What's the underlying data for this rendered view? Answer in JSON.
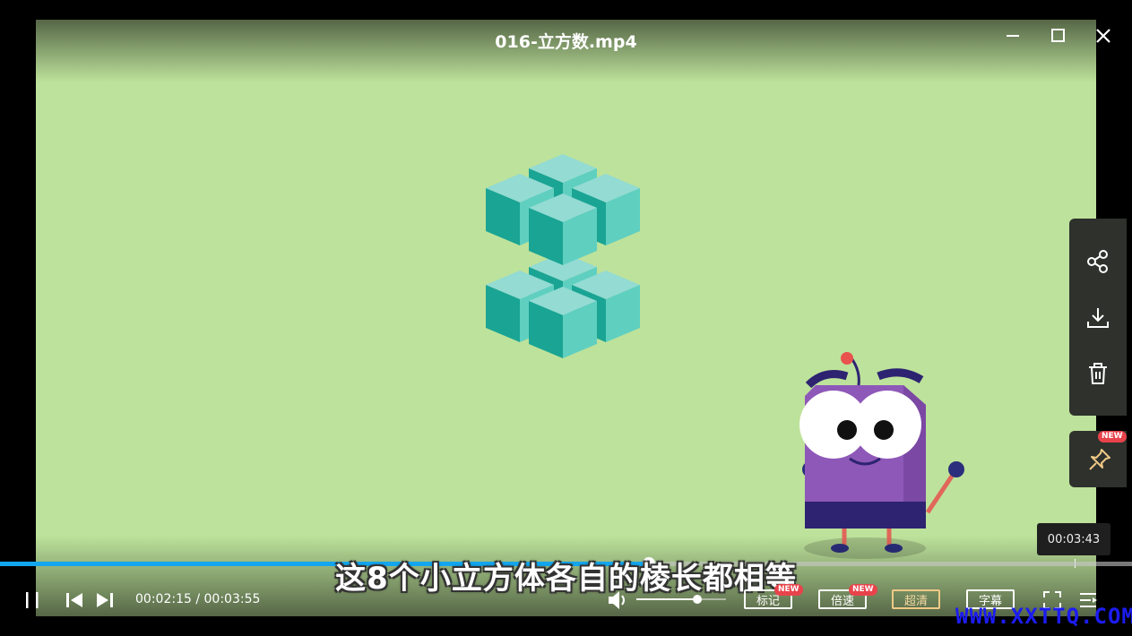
{
  "window": {
    "title": "016-立方数.mp4"
  },
  "side_panel": {
    "icons": [
      "share-icon",
      "download-icon",
      "trash-icon"
    ],
    "pin": {
      "icon": "pin-icon",
      "badge": "NEW"
    }
  },
  "tooltip": {
    "time": "00:03:43"
  },
  "player": {
    "progress": 0.573,
    "subtitle": "这8个小立方体各自的棱长都相等",
    "current_time": "00:02:15",
    "total_time": "00:03:55",
    "time_separator": " / ",
    "volume": 0.68
  },
  "controls": {
    "mark_label": "标记",
    "mark_badge": "NEW",
    "speed_label": "倍速",
    "speed_badge": "NEW",
    "quality_label": "超清",
    "subtitle_label": "字幕"
  },
  "watermark": "WWW.XXTTQ.COM",
  "colors": {
    "video_bg": "#bde29b",
    "progress": "#13a6ee",
    "cube_top": "#93dbd3",
    "cube_left": "#1aa494",
    "cube_right": "#5fcfc0",
    "robot_body": "#8e58b8",
    "watermark": "#1c1cf2"
  }
}
